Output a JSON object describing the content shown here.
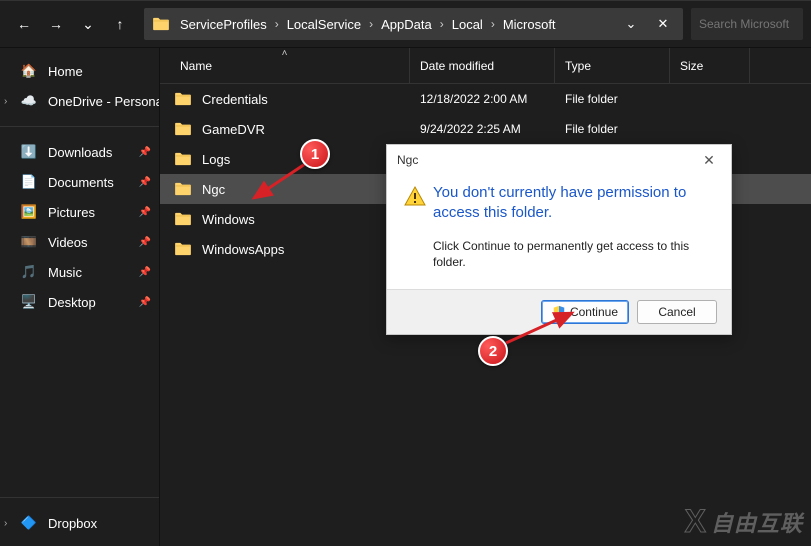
{
  "nav": {
    "back": "←",
    "forward": "→",
    "recent": "⌄",
    "up": "↑"
  },
  "breadcrumb": [
    "ServiceProfiles",
    "LocalService",
    "AppData",
    "Local",
    "Microsoft"
  ],
  "addr": {
    "dropdown": "⌄",
    "refresh": "⟳"
  },
  "search": {
    "placeholder": "Search Microsoft"
  },
  "sidebar": {
    "home": "Home",
    "onedrive": "OneDrive - Personal",
    "downloads": "Downloads",
    "documents": "Documents",
    "pictures": "Pictures",
    "videos": "Videos",
    "music": "Music",
    "desktop": "Desktop",
    "dropbox": "Dropbox",
    "pin": "📌"
  },
  "columns": {
    "name": "Name",
    "date": "Date modified",
    "type": "Type",
    "size": "Size"
  },
  "rows": [
    {
      "name": "Credentials",
      "date": "12/18/2022 2:00 AM",
      "type": "File folder",
      "size": ""
    },
    {
      "name": "GameDVR",
      "date": "9/24/2022 2:25 AM",
      "type": "File folder",
      "size": ""
    },
    {
      "name": "Logs",
      "date": "",
      "type": "",
      "size": ""
    },
    {
      "name": "Ngc",
      "date": "",
      "type": "",
      "size": "",
      "selected": true
    },
    {
      "name": "Windows",
      "date": "",
      "type": "",
      "size": ""
    },
    {
      "name": "WindowsApps",
      "date": "",
      "type": "",
      "size": ""
    }
  ],
  "dialog": {
    "title": "Ngc",
    "heading": "You don't currently have permission to access this folder.",
    "sub": "Click Continue to permanently get access to this folder.",
    "continue": "Continue",
    "cancel": "Cancel"
  },
  "annotations": {
    "one": "1",
    "two": "2"
  },
  "watermark": "自由互联"
}
